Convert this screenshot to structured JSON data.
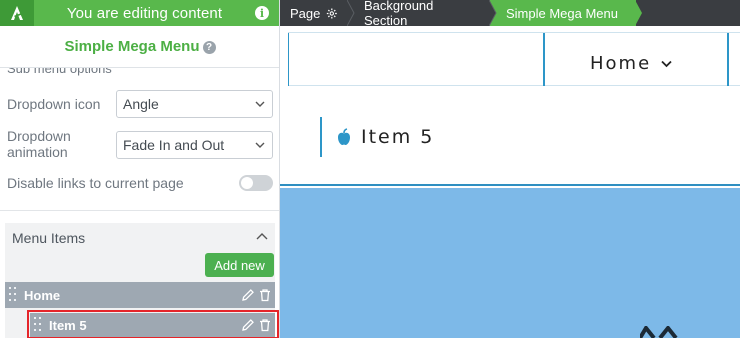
{
  "editor": {
    "banner_title": "You are editing content",
    "logo_icon": "app-logo-icon",
    "info_icon": "info-icon",
    "panel_title": "Simple Mega Menu",
    "help_icon": "help-icon",
    "section_cut_label": "Sub menu options",
    "fields": [
      {
        "label": "Dropdown icon",
        "value": "Angle"
      },
      {
        "label": "Dropdown animation",
        "value": "Fade In and Out"
      }
    ],
    "toggle": {
      "label": "Disable links to current page",
      "on": false
    },
    "menu_items": {
      "title": "Menu Items",
      "add_label": "Add new",
      "rows": [
        {
          "label": "Home",
          "level": 0
        },
        {
          "label": "Item 5",
          "level": 1
        }
      ]
    }
  },
  "breadcrumb": [
    {
      "label": "Page",
      "icon": "gear-icon"
    },
    {
      "label": "Background Section"
    },
    {
      "label": "Simple Mega Menu",
      "active": true
    }
  ],
  "canvas": {
    "nav_label": "Home",
    "dropdown_item": {
      "label": "Item 5",
      "icon": "apple-icon"
    }
  },
  "colors": {
    "editor_green": "#59b84c",
    "highlight_red": "#e5252a",
    "accent_blue": "#2d96c8",
    "light_blue_bg": "#7db9e8",
    "crumb_bar": "#3a3d41"
  }
}
